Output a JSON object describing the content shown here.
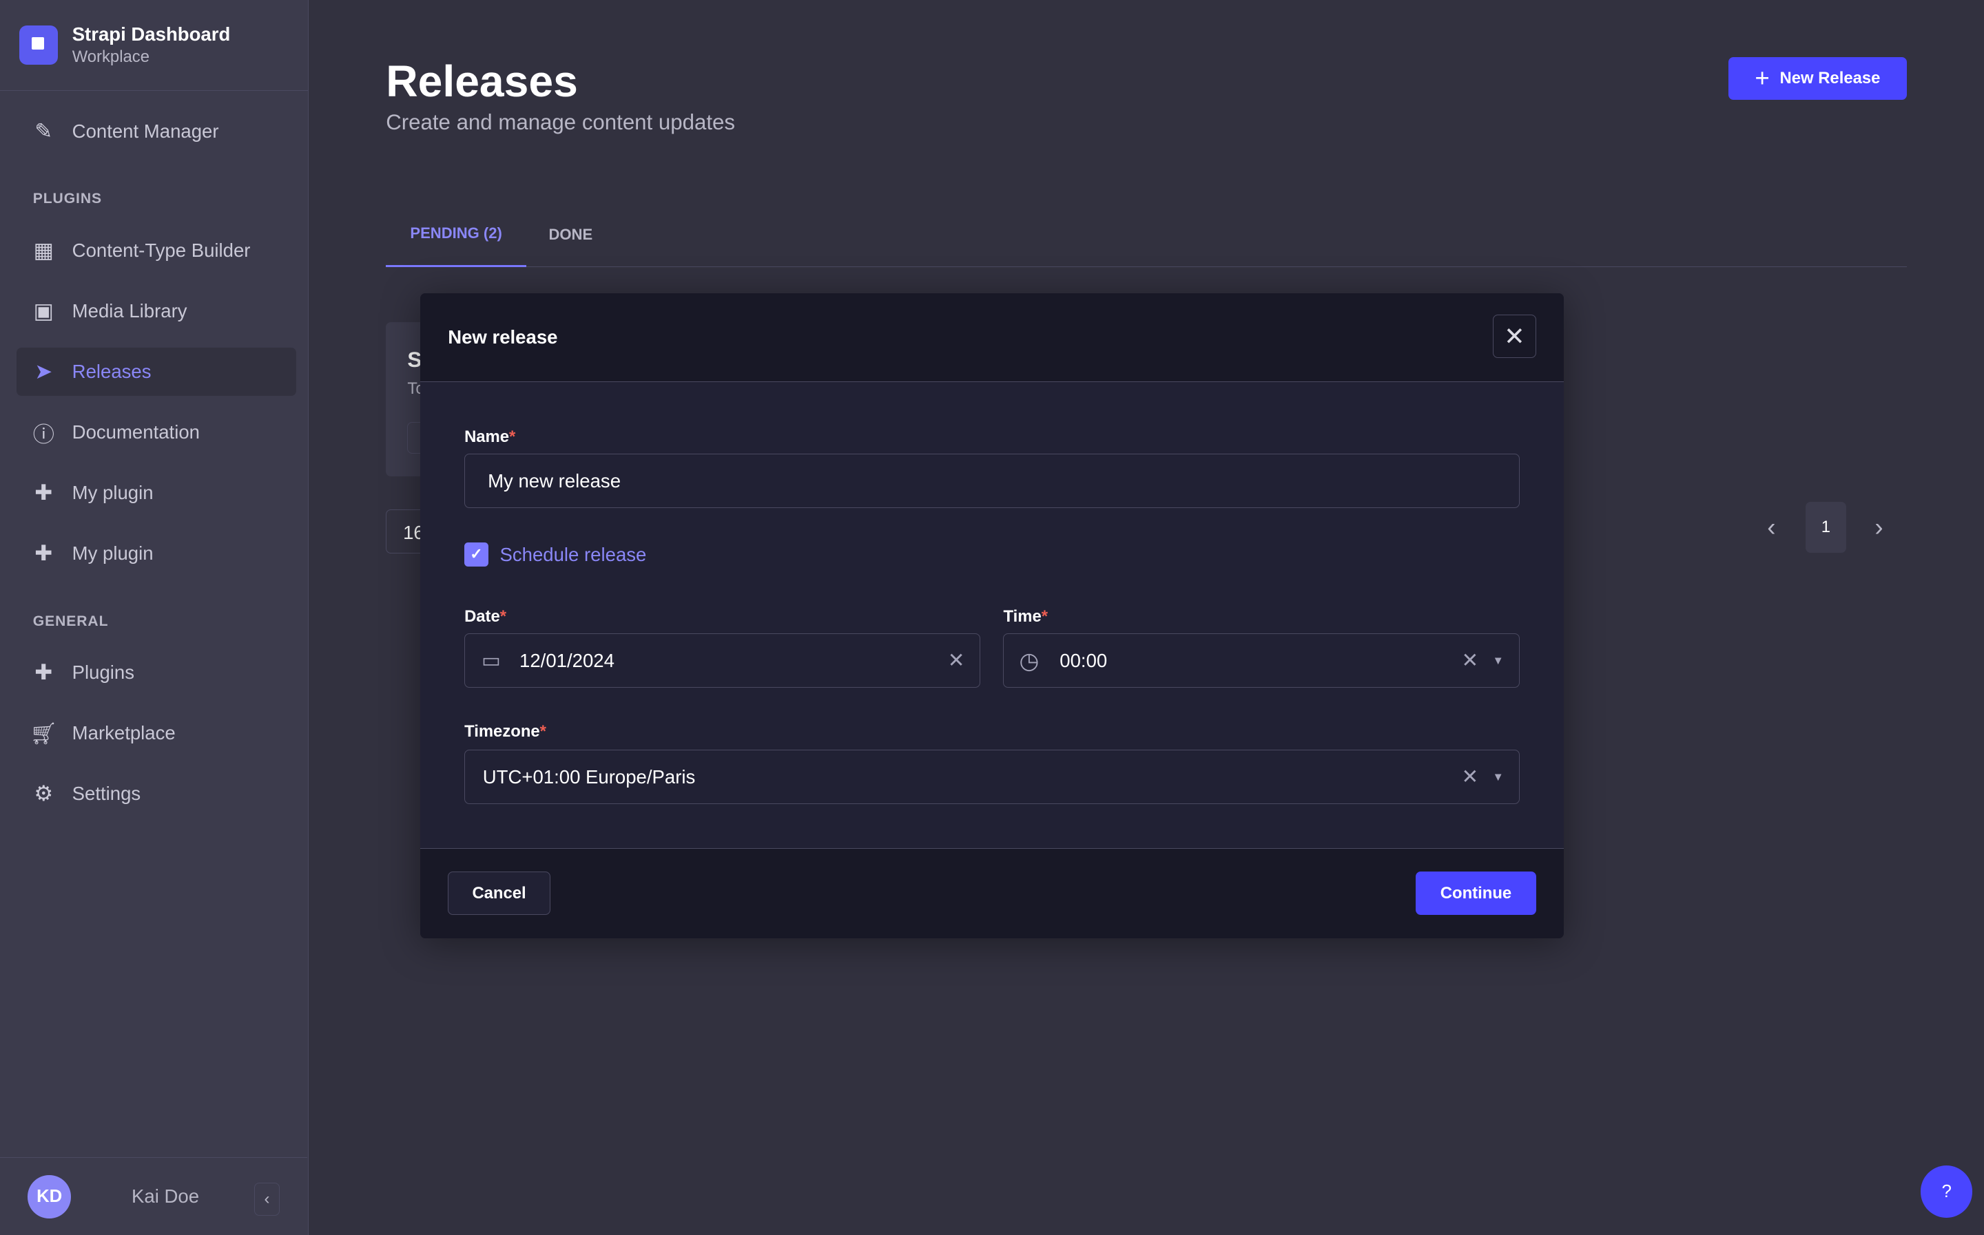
{
  "app": {
    "title": "Strapi Dashboard",
    "workspace": "Workplace"
  },
  "sidebar": {
    "top_item": {
      "label": "Content Manager",
      "icon": "feather-icon"
    },
    "plugins_heading": "PLUGINS",
    "plugins": [
      {
        "label": "Content-Type Builder",
        "icon": "layout-icon"
      },
      {
        "label": "Media Library",
        "icon": "image-icon"
      },
      {
        "label": "Releases",
        "icon": "paper-plane-icon",
        "active": true
      },
      {
        "label": "Documentation",
        "icon": "info-icon"
      },
      {
        "label": "My plugin",
        "icon": "puzzle-icon"
      },
      {
        "label": "My plugin",
        "icon": "puzzle-icon"
      }
    ],
    "general_heading": "GENERAL",
    "general": [
      {
        "label": "Plugins",
        "icon": "puzzle-icon"
      },
      {
        "label": "Marketplace",
        "icon": "cart-icon"
      },
      {
        "label": "Settings",
        "icon": "gear-icon"
      }
    ],
    "user": {
      "initials": "KD",
      "name": "Kai Doe"
    }
  },
  "header": {
    "title": "Releases",
    "subtitle": "Create and manage content updates",
    "new_release_label": "New Release"
  },
  "tabs": [
    {
      "label": "PENDING (2)",
      "active": true
    },
    {
      "label": "DONE"
    }
  ],
  "background": {
    "card_initial": "S",
    "card_sub": "To",
    "page_size": "16",
    "page": "1"
  },
  "modal": {
    "title": "New release",
    "name_label": "Name",
    "name_value": "My new release",
    "schedule_label": "Schedule release",
    "schedule_checked": true,
    "date_label": "Date",
    "date_value": "12/01/2024",
    "time_label": "Time",
    "time_value": "00:00",
    "timezone_label": "Timezone",
    "timezone_value": "UTC+01:00 Europe/Paris",
    "required_mark": "*",
    "cancel_label": "Cancel",
    "continue_label": "Continue"
  },
  "help_label": "?",
  "colors": {
    "accent": "#4945ff",
    "accent_light": "#8a87f7",
    "required": "#ee5e52"
  }
}
